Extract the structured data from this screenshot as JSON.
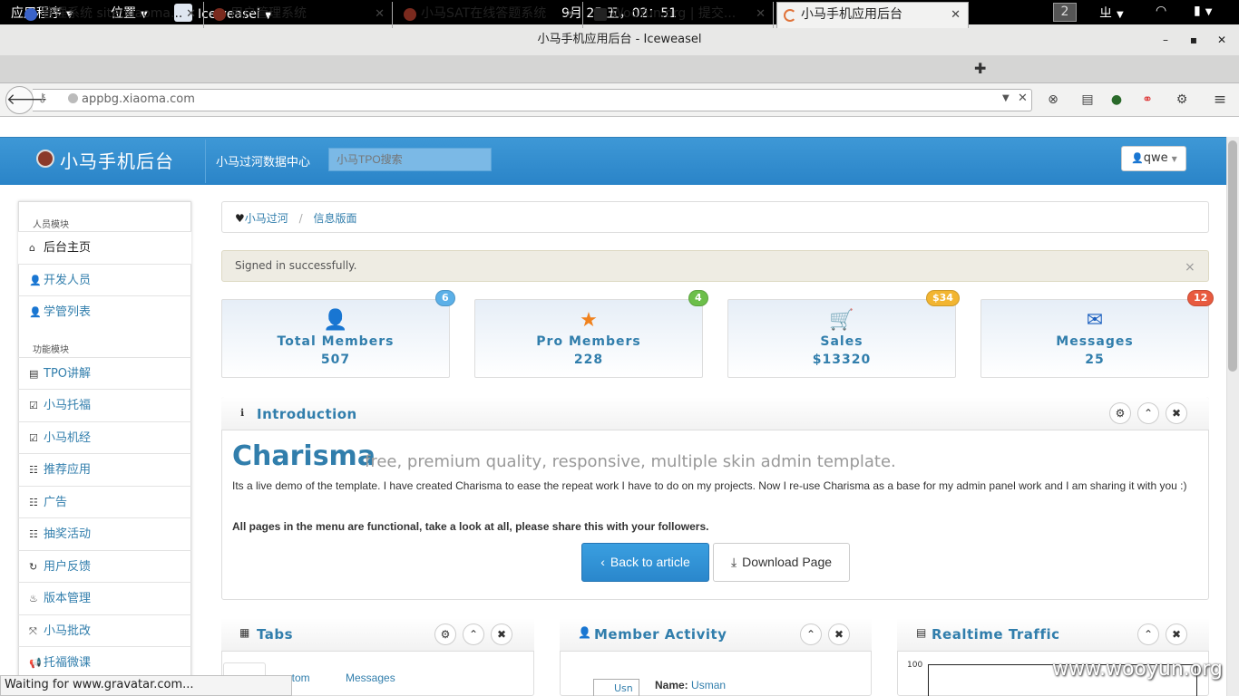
{
  "topbar": {
    "apps": "应用程序",
    "places": "位置",
    "browser": "Iceweasel",
    "clock": "9月 25 五，02：51",
    "workspace": "2",
    "input_method": "ㄓ"
  },
  "window": {
    "title": "小马手机应用后台 - Iceweasel",
    "min": "–",
    "max": "▪",
    "close": "✕"
  },
  "tabs": [
    {
      "label": "管理系统 site:xiaoma...",
      "close": "✕"
    },
    {
      "label": "用户管理系统",
      "close": "✕"
    },
    {
      "label": "小马SAT在线答题系统",
      "close": "✕"
    },
    {
      "label": "WooYun.org | 提交...",
      "close": "✕"
    },
    {
      "label": "小马手机应用后台",
      "close": "✕"
    }
  ],
  "new_tab": "✚",
  "address": {
    "url": "appbg.xiaoma.com"
  },
  "site": {
    "brand": "小马手机后台",
    "nav_link": "小马过河数据中心",
    "search_placeholder": "小马TPO搜索",
    "user": "qwe"
  },
  "sidebar": {
    "head1": "人员模块",
    "head2": "功能模块",
    "items": [
      {
        "label": "后台主页",
        "icon": "home-icon",
        "glyph": "⌂"
      },
      {
        "label": "开发人员",
        "icon": "user-icon",
        "glyph": "👤"
      },
      {
        "label": "学管列表",
        "icon": "user-icon",
        "glyph": "👤"
      },
      {
        "label": "TPO讲解",
        "icon": "list-icon",
        "glyph": "▤"
      },
      {
        "label": "小马托福",
        "icon": "edit-icon",
        "glyph": "☑"
      },
      {
        "label": "小马机经",
        "icon": "edit-icon",
        "glyph": "☑"
      },
      {
        "label": "推荐应用",
        "icon": "list-icon",
        "glyph": "☷"
      },
      {
        "label": "广告",
        "icon": "list-icon",
        "glyph": "☷"
      },
      {
        "label": "抽奖活动",
        "icon": "list-icon",
        "glyph": "☷"
      },
      {
        "label": "用户反馈",
        "icon": "refresh-icon",
        "glyph": "↻"
      },
      {
        "label": "版本管理",
        "icon": "fire-icon",
        "glyph": "♨"
      },
      {
        "label": "小马批改",
        "icon": "fullscreen-icon",
        "glyph": "⤧"
      },
      {
        "label": "托福微课",
        "icon": "bullhorn-icon",
        "glyph": "📢"
      }
    ]
  },
  "breadcrumb": {
    "home": "小马过河",
    "sep": "/",
    "current": "信息版面"
  },
  "alert": {
    "text": "Signed in successfully.",
    "close": "×"
  },
  "stats": [
    {
      "title": "Total Members",
      "value": "507",
      "badge": "6",
      "badge_color": "#5bb0e8",
      "icon": "user-icon",
      "glyph": "👤",
      "color": "#c9302c"
    },
    {
      "title": "Pro Members",
      "value": "228",
      "badge": "4",
      "badge_color": "#6cbf4a",
      "icon": "star-icon",
      "glyph": "★",
      "color": "#f0821e"
    },
    {
      "title": "Sales",
      "value": "$13320",
      "badge": "$34",
      "badge_color": "#f2b531",
      "icon": "cart-icon",
      "glyph": "🛒",
      "color": "#3aa839"
    },
    {
      "title": "Messages",
      "value": "25",
      "badge": "12",
      "badge_color": "#e85a3f",
      "icon": "envelope-icon",
      "glyph": "✉",
      "color": "#1b5fbf"
    }
  ],
  "intro": {
    "title": "Introduction",
    "brand": "Charisma",
    "tagline": "free, premium quality, responsive, multiple skin admin template.",
    "description": "Its a live demo of the template. I have created Charisma to ease the repeat work I have to do on my projects. Now I re-use Charisma as a base for my admin panel work and I am sharing it with you :)",
    "bold": "All pages in the menu are functional, take a look at all, please share this with your followers.",
    "back": "Back to article",
    "download": "Download Page"
  },
  "panels": {
    "tabs_title": "Tabs",
    "tab_custom": "ustom",
    "tab_messages": "Messages",
    "member_title": "Member Activity",
    "member_name_label": "Name:",
    "member_name": "Usman",
    "member_avatar": "Usn",
    "traffic_title": "Realtime Traffic",
    "traffic_axis": "100"
  },
  "status": "Waiting for www.gravatar.com...",
  "watermark": "www.wooyun.org"
}
